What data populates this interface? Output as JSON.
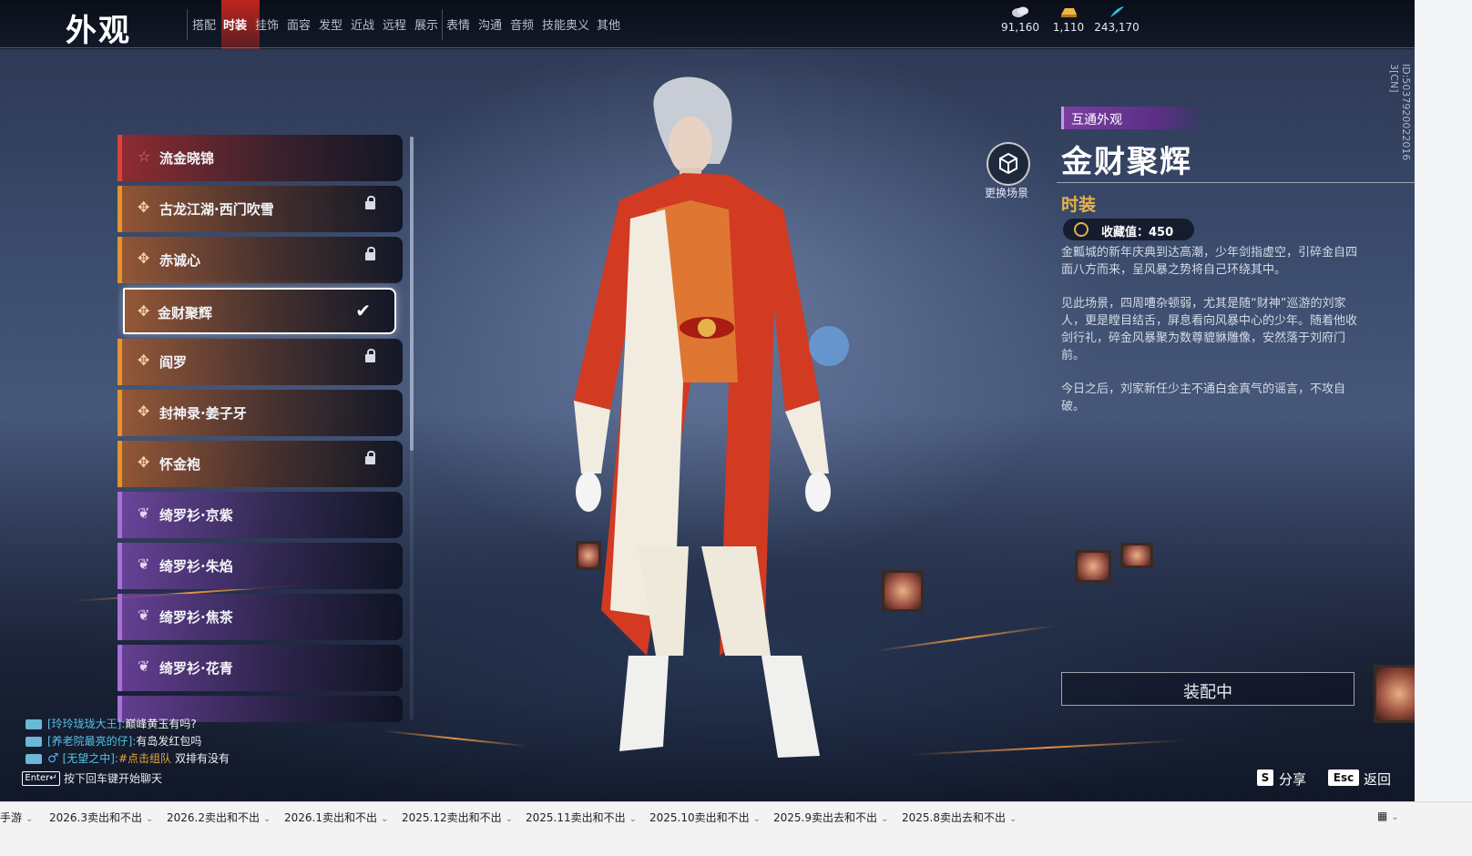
{
  "header": {
    "title": "外观",
    "tabs": [
      {
        "label": "搭配"
      },
      {
        "label": "时装"
      },
      {
        "label": "挂饰"
      },
      {
        "label": "面容"
      },
      {
        "label": "发型"
      },
      {
        "label": "近战"
      },
      {
        "label": "远程"
      },
      {
        "label": "展示"
      },
      {
        "label": "表情"
      },
      {
        "label": "沟通"
      },
      {
        "label": "音频"
      },
      {
        "label": "技能奥义"
      },
      {
        "label": "其他"
      }
    ],
    "active_tab": "时装",
    "currencies": [
      {
        "icon": "coin-icon",
        "value": "91,160"
      },
      {
        "icon": "gold-ingot-icon",
        "value": "1,110"
      },
      {
        "icon": "feather-icon",
        "value": "243,170"
      }
    ]
  },
  "items": [
    {
      "name": "流金晓锦",
      "rarity": "red",
      "locked": false,
      "selected": false
    },
    {
      "name": "古龙江湖·西门吹雪",
      "rarity": "orange",
      "locked": true,
      "selected": false
    },
    {
      "name": "赤诚心",
      "rarity": "orange",
      "locked": true,
      "selected": false
    },
    {
      "name": "金财聚辉",
      "rarity": "orange",
      "locked": false,
      "selected": true
    },
    {
      "name": "阎罗",
      "rarity": "orange",
      "locked": true,
      "selected": false
    },
    {
      "name": "封神录·姜子牙",
      "rarity": "orange",
      "locked": false,
      "selected": false
    },
    {
      "name": "怀金袍",
      "rarity": "orange",
      "locked": true,
      "selected": false
    },
    {
      "name": "绮罗衫·京紫",
      "rarity": "purple",
      "locked": false,
      "selected": false
    },
    {
      "name": "绮罗衫·朱焰",
      "rarity": "purple",
      "locked": false,
      "selected": false
    },
    {
      "name": "绮罗衫·焦茶",
      "rarity": "purple",
      "locked": false,
      "selected": false
    },
    {
      "name": "绮罗衫·花青",
      "rarity": "purple",
      "locked": false,
      "selected": false
    }
  ],
  "detail": {
    "scene_button": "更换场景",
    "tag": "互通外观",
    "name": "金财聚辉",
    "category": "时装",
    "collection": "收藏值：450",
    "desc": [
      "金瓤城的新年庆典到达高潮，少年剑指虚空，引碎金自四面八方而来，呈风暴之势将自己环绕其中。",
      "见此场景，四周嘈杂顿弱，尤其是随“财神”巡游的刘家人，更是瞠目结舌，屏息看向风暴中心的少年。随着他收剑行礼，碎金风暴聚为数尊貔貅雕像，安然落于刘府门前。",
      "今日之后，刘家新任少主不通白金真气的谣言，不攻自破。"
    ],
    "equip_button": "装配中",
    "side_id": "ID:5037920022016 3[CN]"
  },
  "shortcuts": [
    {
      "key": "S",
      "label": "分享"
    },
    {
      "key": "Esc",
      "label": "返回"
    }
  ],
  "chat": {
    "messages": [
      {
        "who": "[玲玲珑珑大王]:",
        "msg": "巅峰黄玉有吗?",
        "link": ""
      },
      {
        "who": "[养老院最亮的仔]:",
        "msg": "有岛发红包吗",
        "link": ""
      },
      {
        "who": "[无望之中]:",
        "msg": "双排有没有",
        "link": "#点击组队",
        "gender": "♂"
      }
    ],
    "enter_key": "Enter↵",
    "hint": "按下回车键开始聊天"
  },
  "sheets": [
    "手游",
    "2026.3卖出和不出",
    "2026.2卖出和不出",
    "2026.1卖出和不出",
    "2025.12卖出和不出",
    "2025.11卖出和不出",
    "2025.10卖出和不出",
    "2025.9卖出去和不出",
    "2025.8卖出去和不出"
  ],
  "colors": {
    "red": "#d8443c",
    "orange": "#e6932e",
    "purple": "#a870d8",
    "gold": "#e6b24a",
    "active_tab": "#c8281e"
  }
}
